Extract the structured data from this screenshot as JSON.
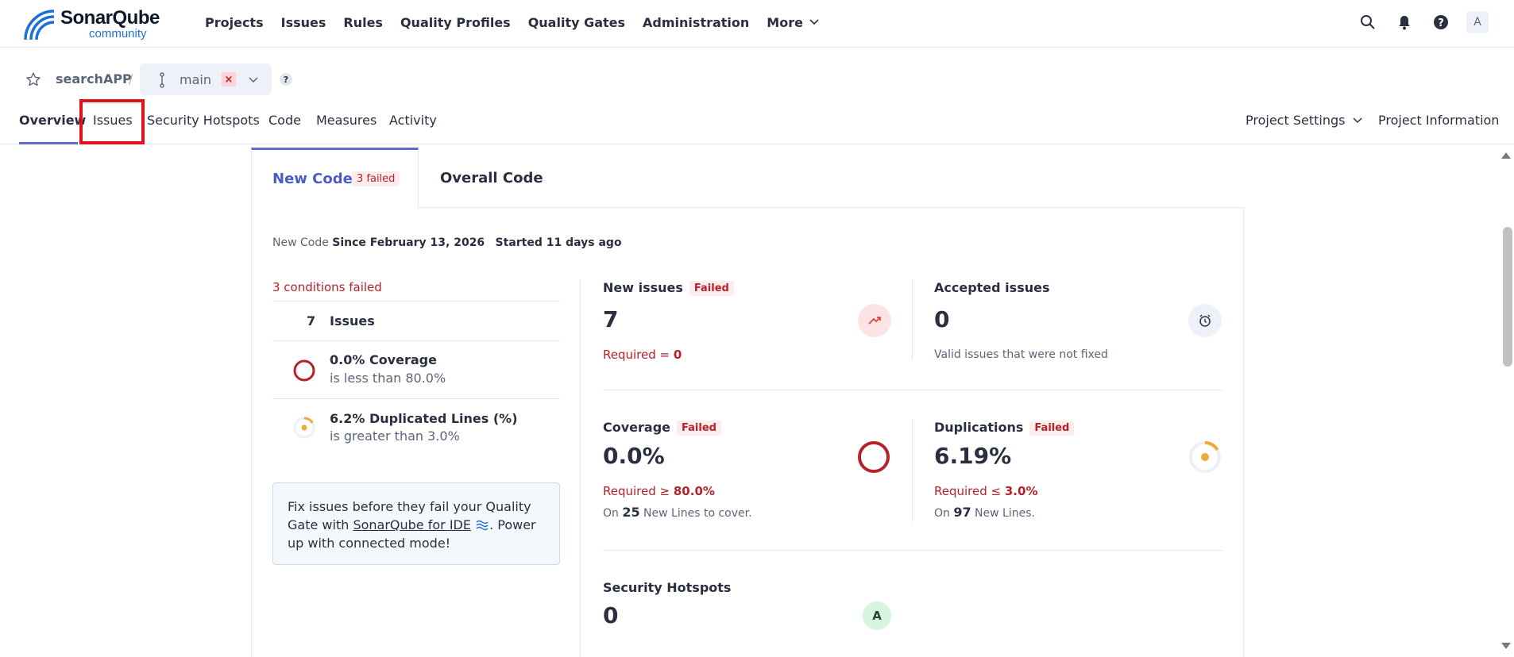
{
  "app": {
    "logo_word": "SonarQube",
    "logo_sub": "community"
  },
  "nav": {
    "items": [
      "Projects",
      "Issues",
      "Rules",
      "Quality Profiles",
      "Quality Gates",
      "Administration",
      "More"
    ],
    "avatar_letter": "A"
  },
  "project": {
    "name": "searchAPP",
    "separator": "/",
    "branch": "main",
    "branch_remove": "×",
    "help": "?"
  },
  "tabs": {
    "items": [
      "Overview",
      "Issues",
      "Security Hotspots",
      "Code",
      "Measures",
      "Activity"
    ],
    "active": "Overview",
    "highlighted": "Issues",
    "settings": "Project Settings",
    "info": "Project Information"
  },
  "main_tabs": {
    "new_code": "New Code",
    "new_code_badge": "3 failed",
    "overall_code": "Overall Code"
  },
  "since": {
    "label": "New Code",
    "since_text": "Since February 13, 2026",
    "started_text": "Started 11 days ago"
  },
  "conditions": {
    "header": "3 conditions failed",
    "items": [
      {
        "num": "7",
        "title": "Issues",
        "sub": ""
      },
      {
        "title": "0.0% Coverage",
        "sub": "is less than 80.0%"
      },
      {
        "title": "6.2% Duplicated Lines (%)",
        "sub": "is greater than 3.0%"
      }
    ]
  },
  "tip": {
    "line1": "Fix issues before they fail your Quality Gate with ",
    "link": "SonarQube for IDE",
    "line2": ". Power up with connected mode!"
  },
  "metrics": {
    "failed_label": "Failed",
    "new_issues": {
      "title": "New issues",
      "value": "7",
      "req_label": "Required = ",
      "req_value": "0"
    },
    "accepted": {
      "title": "Accepted issues",
      "value": "0",
      "note": "Valid issues that were not fixed"
    },
    "coverage": {
      "title": "Coverage",
      "value": "0.0%",
      "req_label": "Required ≥ ",
      "req_value": "80.0%",
      "note_pre": "On ",
      "note_num": "25",
      "note_post": " New Lines to cover."
    },
    "duplications": {
      "title": "Duplications",
      "value": "6.19%",
      "req_label": "Required ≤ ",
      "req_value": "3.0%",
      "note_pre": "On ",
      "note_num": "97",
      "note_post": " New Lines."
    },
    "hotspots": {
      "title": "Security Hotspots",
      "value": "0",
      "rating": "A"
    }
  },
  "colors": {
    "accent": "#5d6cd0",
    "error": "#b4222a",
    "highlight": "#e3111b",
    "duplication": "#f0a93a",
    "rating_a": "#d6f5de"
  }
}
